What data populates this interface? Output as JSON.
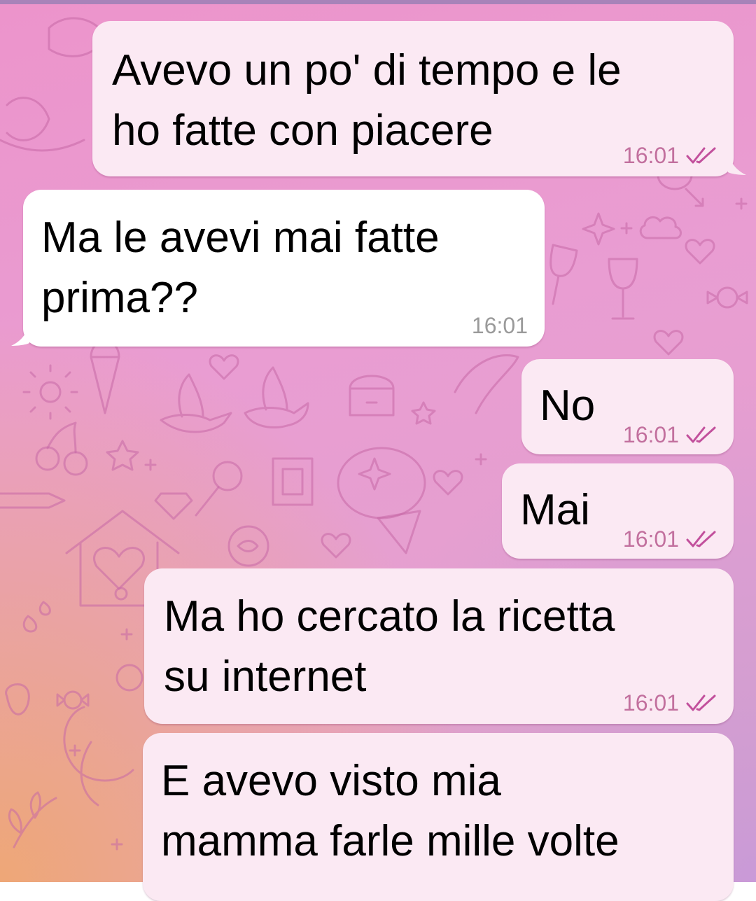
{
  "theme": {
    "outgoing_bubble_color": "#fbe9f3",
    "incoming_bubble_color": "#ffffff",
    "outgoing_meta_color": "#c2709e",
    "incoming_meta_color": "#9a9a9a",
    "check_color": "#c2509c",
    "wallpaper_colors": [
      "#ec94cb",
      "#e4a0cf",
      "#eea777",
      "#c99ad8"
    ]
  },
  "messages": [
    {
      "direction": "outgoing",
      "lines": [
        "Avevo un po' di tempo e le",
        "ho fatte con piacere"
      ],
      "time": "16:01",
      "status_icon": "double-check-read-icon"
    },
    {
      "direction": "incoming",
      "lines": [
        "Ma le avevi mai fatte",
        "prima??"
      ],
      "time": "16:01"
    },
    {
      "direction": "outgoing",
      "lines": [
        "No"
      ],
      "time": "16:01",
      "status_icon": "double-check-read-icon"
    },
    {
      "direction": "outgoing",
      "lines": [
        "Mai"
      ],
      "time": "16:01",
      "status_icon": "double-check-read-icon"
    },
    {
      "direction": "outgoing",
      "lines": [
        "Ma ho cercato la ricetta",
        "su internet"
      ],
      "time": "16:01",
      "status_icon": "double-check-read-icon"
    },
    {
      "direction": "outgoing",
      "lines": [
        "E avevo visto mia",
        "mamma farle mille volte"
      ]
    }
  ]
}
